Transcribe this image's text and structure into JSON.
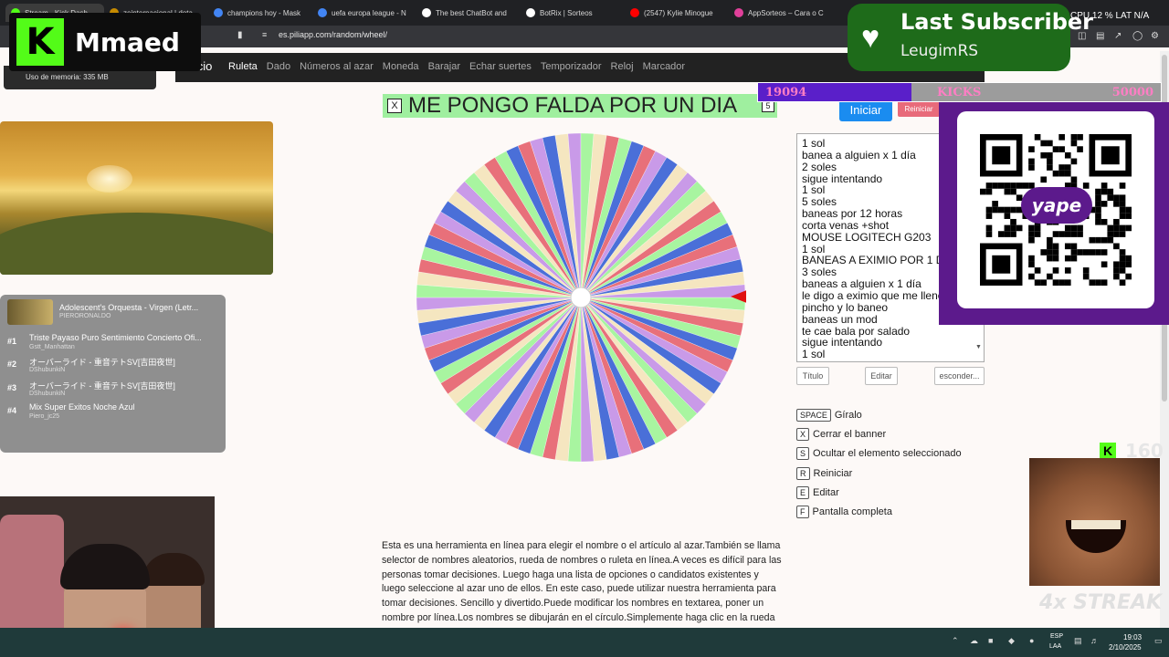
{
  "browser": {
    "tabs": [
      {
        "label": "Stream - Kick Dash",
        "color": "#53fc18",
        "active": true
      },
      {
        "label": "zeinternacional | dota",
        "color": "#c58a00"
      },
      {
        "label": "champions hoy - Mask",
        "color": "#4285f4"
      },
      {
        "label": "uefa europa league - N",
        "color": "#4285f4"
      },
      {
        "label": "The best ChatBot and",
        "color": "#ffffff"
      },
      {
        "label": "BotRix | Sorteos",
        "color": "#ffffff"
      },
      {
        "label": "(2547) Kylie Minogue",
        "color": "#ff0000"
      },
      {
        "label": "AppSorteos – Cara o C",
        "color": "#e0409a"
      }
    ],
    "url": "es.piliapp.com/random/wheel/",
    "cpu": "CPU 12 %   LAT N/A"
  },
  "site_nav": {
    "brand": "Inicio",
    "items": [
      {
        "label": "Ruleta",
        "current": true
      },
      {
        "label": "Dado"
      },
      {
        "label": "Números al azar"
      },
      {
        "label": "Moneda"
      },
      {
        "label": "Barajar"
      },
      {
        "label": "Echar suertes"
      },
      {
        "label": "Temporizador"
      },
      {
        "label": "Reloj"
      },
      {
        "label": "Marcador"
      }
    ]
  },
  "overlay": {
    "kick_letter": "K",
    "kick_name": "Mmaed",
    "memory": "Uso de memoria: 335 MB",
    "music": {
      "now_title": "Adolescent's Orquesta - Virgen (Letr...",
      "now_artist": "PIERORONALDO",
      "queue": [
        {
          "num": "#1",
          "title": "Triste Payaso Puro Sentimiento Concierto Ofi...",
          "artist": "Gstt_Manhattan"
        },
        {
          "num": "#2",
          "title": "オーバーライド - 重音テトSV[吉田夜世]",
          "artist": "DShubunkiN"
        },
        {
          "num": "#3",
          "title": "オーバーライド - 重音テトSV[吉田夜世]",
          "artist": "DShubunkiN"
        },
        {
          "num": "#4",
          "title": "Mix Super Exitos Noche Azul",
          "artist": "Piero_jc25"
        }
      ]
    },
    "subscriber": {
      "title": "Last Subscriber",
      "name": "LeugimRS"
    },
    "kicks": {
      "current": "19094",
      "label": "KICKS",
      "goal": "50000",
      "progress": 0.38
    },
    "qr_label": "yape",
    "streak": {
      "count": "160",
      "label": "4x STREAK"
    }
  },
  "wheel": {
    "title": "ME PONGO FALDA POR UN DIA",
    "close_key": "X",
    "count_badge": "5",
    "start_label": "Iniciar",
    "reset_label": "Reiniciar",
    "segment_count": 80,
    "colors": [
      "#a8f5a0",
      "#e8707a",
      "#4a6fd8",
      "#c99ae8",
      "#f5e6c0"
    ],
    "pointer_color": "#e01010"
  },
  "options": [
    "1 sol",
    "banea a alguien x 1 día",
    "2 soles",
    "sigue intentando",
    "1 sol",
    "5 soles",
    "baneas por 12 horas",
    "corta venas +shot",
    "MOUSE LOGITECH G203",
    "1 sol",
    "BANEAS A EXIMIO POR 1 DIA",
    "3 soles",
    "baneas a alguien x 1 día",
    "le digo a eximio que me llene",
    "pincho y lo baneo",
    "baneas un mod",
    "te cae bala por salado",
    "sigue intentando",
    "1 sol"
  ],
  "buttons": {
    "titulo": "Título",
    "editar": "Editar",
    "esconder": "esconder..."
  },
  "shortcuts": [
    {
      "key": "SPACE",
      "label": "Gíralo"
    },
    {
      "key": "X",
      "label": "Cerrar el banner"
    },
    {
      "key": "S",
      "label": "Ocultar el elemento seleccionado"
    },
    {
      "key": "R",
      "label": "Reiniciar"
    },
    {
      "key": "E",
      "label": "Editar"
    },
    {
      "key": "F",
      "label": "Pantalla completa"
    }
  ],
  "description": "Esta es una herramienta en línea para elegir el nombre o el artículo al azar.También se llama selector de nombres aleatorios, rueda de nombres o ruleta en línea.A veces es difícil para las personas tomar decisiones. Luego haga una lista de opciones o candidatos existentes y luego seleccione al azar uno de ellos. En este caso, puede utilizar nuestra herramienta para tomar decisiones. Sencillo y divertido.Puede modificar los nombres en textarea, poner un nombre por línea.Los nombres se dibujarán en el círculo.Simplemente haga clic en la rueda",
  "taskbar": {
    "lang_top": "ESP",
    "lang_bottom": "LAA",
    "time": "19:03",
    "date": "2/10/2025"
  }
}
